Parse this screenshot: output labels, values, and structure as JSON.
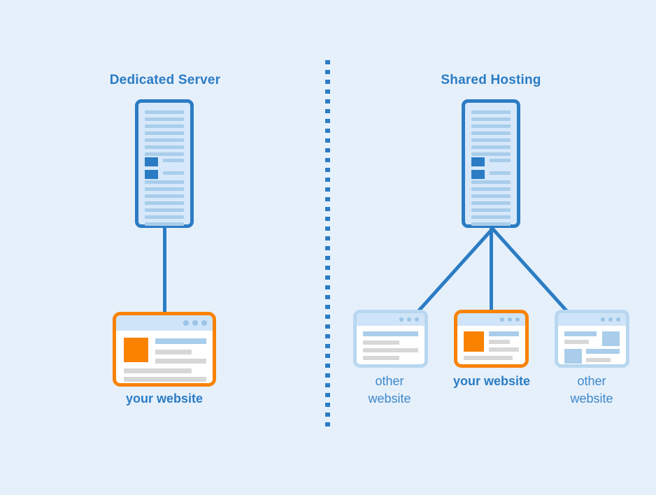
{
  "background_color": "#e6f0fb",
  "theme": {
    "blue": "#2b7cc4",
    "light_blue": "#a9cdeb",
    "pale_blue": "#cfe4f8",
    "card_border_blue": "#b8d7f0",
    "orange": "#f98200",
    "gray": "#d7d7d7",
    "white": "#ffffff"
  },
  "panels": {
    "left": {
      "title": "Dedicated Server",
      "server_name": "dedicated-server-tower",
      "website_label": "your website",
      "highlighted": true
    },
    "right": {
      "title": "Shared Hosting",
      "server_name": "shared-server-tower",
      "sites": [
        {
          "label": "other\nwebsite",
          "highlighted": false
        },
        {
          "label": "your website",
          "highlighted": true
        },
        {
          "label": "other\nwebsite",
          "highlighted": false
        }
      ]
    }
  },
  "divider": {
    "style": "dashed-vertical",
    "color": "#2b7cc4"
  }
}
